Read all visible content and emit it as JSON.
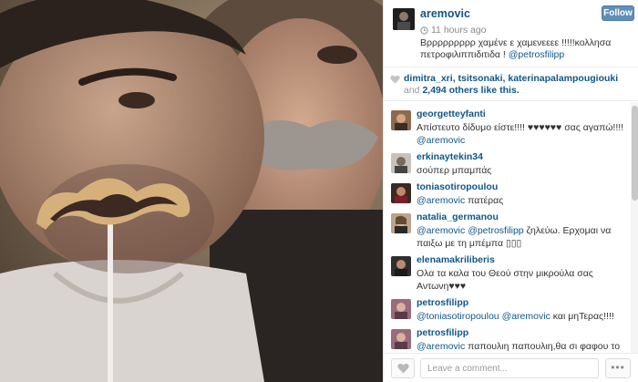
{
  "post": {
    "username": "aremovic",
    "time": "11 hours ago",
    "caption_text": "Βρρρρρρρρρ χαμένε ε χαμενεεεε !!!!!κολλησα πετροφιλιππιδιτιδα ! ",
    "caption_mention": "@petrosfilipp",
    "follow_label": "Follow"
  },
  "likes": {
    "likers": "dimitra_xri, tsitsonaki, katerinapalampougiouki",
    "and_text": " and ",
    "others": "2,494 others like this."
  },
  "comments": [
    {
      "user": "georgetteyfanti",
      "parts": [
        {
          "t": "Απίστευτο δίδυμο είστε!!!! ♥♥♥♥♥♥ σας αγαπώ!!!! "
        },
        {
          "m": "@aremovic"
        }
      ]
    },
    {
      "user": "erkinaytekin34",
      "parts": [
        {
          "t": "σούπερ μπαμπάς"
        }
      ]
    },
    {
      "user": "toniasotiropoulou",
      "parts": [
        {
          "m": "@aremovic"
        },
        {
          "t": " πατέρας"
        }
      ]
    },
    {
      "user": "natalia_germanou",
      "parts": [
        {
          "m": "@aremovic"
        },
        {
          "t": " "
        },
        {
          "m": "@petrosfilipp"
        },
        {
          "t": " ζηλεύω. Ερχομαι να παιξω με τη μπέμπα ▯▯▯"
        }
      ]
    },
    {
      "user": "elenamakriliberis",
      "parts": [
        {
          "t": "Ολα τα καλα του Θεού στην μικρούλα σας Αντωνη♥♥♥"
        }
      ]
    },
    {
      "user": "petrosfilipp",
      "parts": [
        {
          "m": "@toniasotiropoulou"
        },
        {
          "t": " "
        },
        {
          "m": "@aremovic"
        },
        {
          "t": " και μηΤερας!!!!"
        }
      ]
    },
    {
      "user": "petrosfilipp",
      "parts": [
        {
          "m": "@aremovic"
        },
        {
          "t": " παπουλιη παπουλιη,θα σι φαφου το"
        }
      ]
    }
  ],
  "footer": {
    "comment_placeholder": "Leave a comment...",
    "more_label": "•••"
  },
  "colors": {
    "link": "#125688",
    "follow_button": "#5f8fb9"
  }
}
